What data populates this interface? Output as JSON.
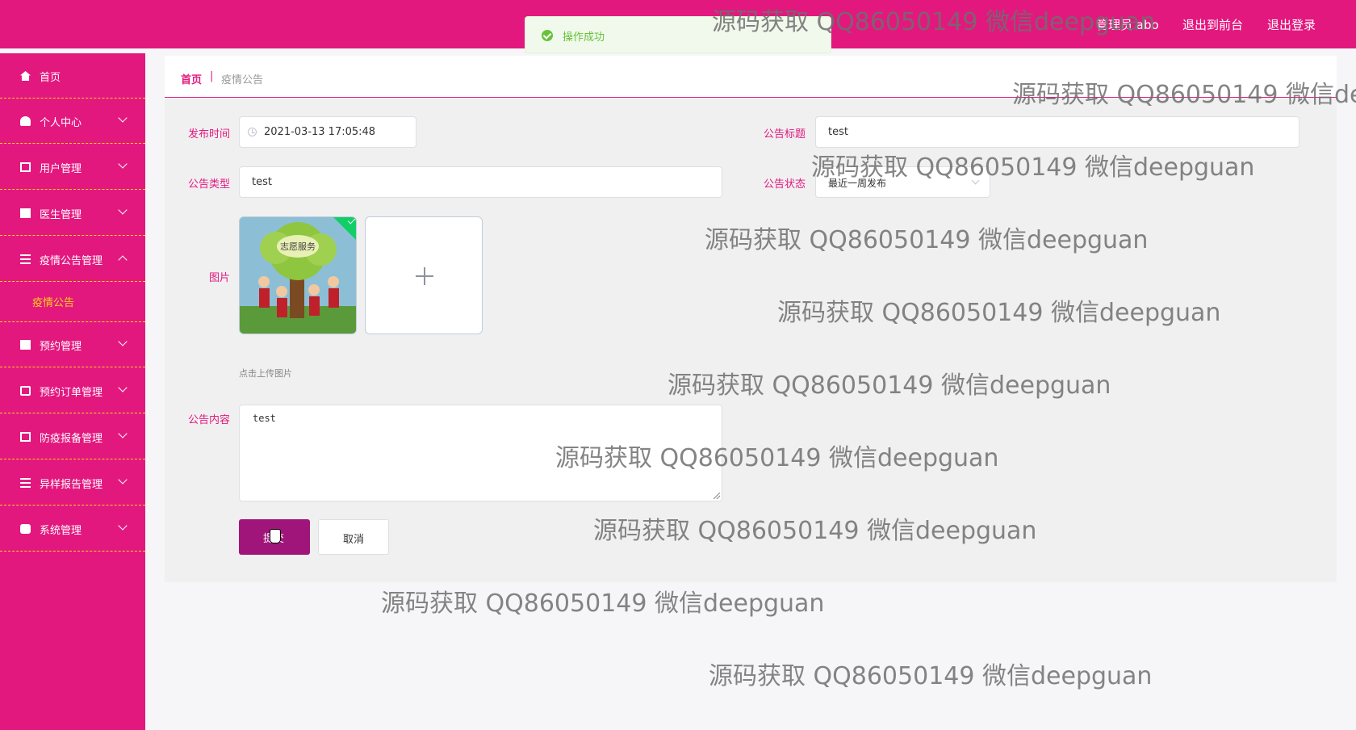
{
  "header": {
    "admin_label": "管理员 abo",
    "to_front_label": "退出到前台",
    "logout_label": "退出登录"
  },
  "toast": {
    "message": "操作成功"
  },
  "sidebar": {
    "items": [
      {
        "label": "首页",
        "icon": "home-icon"
      },
      {
        "label": "个人中心",
        "icon": "user-icon"
      },
      {
        "label": "用户管理",
        "icon": "copy-icon"
      },
      {
        "label": "医生管理",
        "icon": "chart-icon"
      },
      {
        "label": "疫情公告管理",
        "icon": "list-icon"
      },
      {
        "label": "预约管理",
        "icon": "clipboard-icon"
      },
      {
        "label": "预约订单管理",
        "icon": "chat-icon"
      },
      {
        "label": "防疫报备管理",
        "icon": "report-icon"
      },
      {
        "label": "异样报告管理",
        "icon": "list-icon"
      },
      {
        "label": "系统管理",
        "icon": "gear-icon"
      }
    ],
    "active_sub": "疫情公告"
  },
  "breadcrumb": {
    "home": "首页",
    "separator": "|",
    "current": "疫情公告"
  },
  "form": {
    "publish_time": {
      "label": "发布时间",
      "value": "2021-03-13 17:05:48"
    },
    "title": {
      "label": "公告标题",
      "value": "test"
    },
    "type": {
      "label": "公告类型",
      "value": "test"
    },
    "status": {
      "label": "公告状态",
      "value": "最近一周发布"
    },
    "image": {
      "label": "图片",
      "tip": "点击上传图片",
      "thumb_text": "志愿服务"
    },
    "content": {
      "label": "公告内容",
      "value": "test"
    },
    "submit_label": "提交",
    "cancel_label": "取消"
  },
  "watermark": "源码获取 QQ86050149 微信deepguan",
  "colors": {
    "primary": "#e3187f",
    "sub_active": "#f7d117",
    "success": "#67c23a",
    "submit_button": "#a0157a"
  }
}
